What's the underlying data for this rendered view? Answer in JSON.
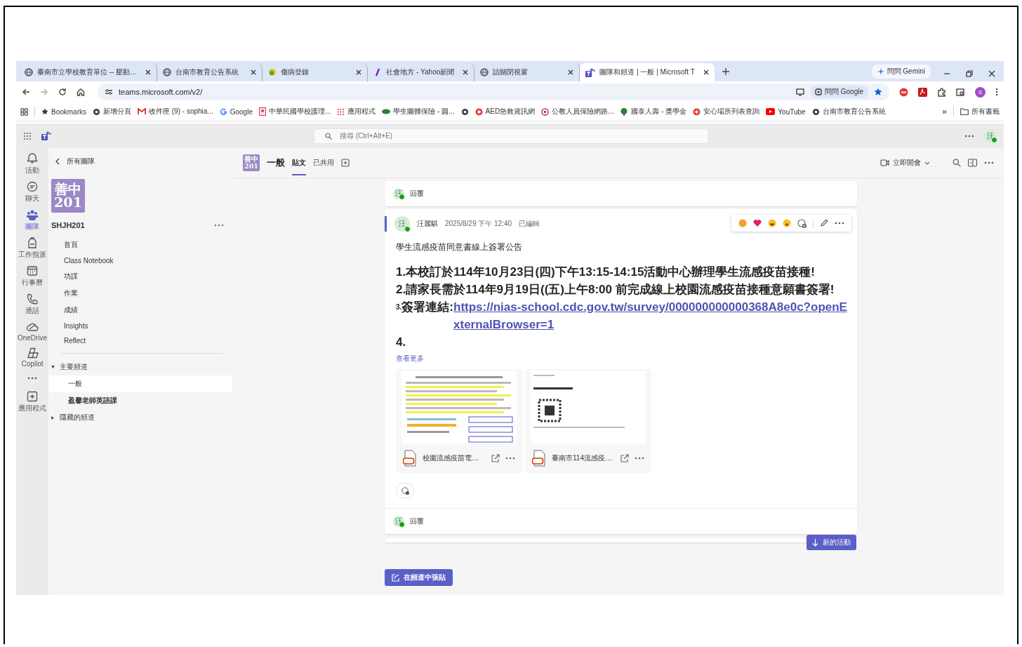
{
  "browser": {
    "tabs": [
      {
        "title": "臺南市立學校教育單位 -- 壓動…",
        "selected": false
      },
      {
        "title": "台南市教育公告系統",
        "selected": false
      },
      {
        "title": "傷病登錄",
        "selected": false
      },
      {
        "title": "社會地方 - Yahoo新聞",
        "selected": false
      },
      {
        "title": "請關閉視窗",
        "selected": false
      },
      {
        "title": "團隊和頻道 | 一般 | Microsoft T",
        "selected": true
      }
    ],
    "gemini": "問問 Gemini",
    "address": "teams.microsoft.com/v2/",
    "lens": "問問 Google",
    "profile": "S",
    "bookmarks": [
      "Bookmarks",
      "新增分頁",
      "收件匣 (9) - sophia...",
      "Google",
      "中華民國學校護理...",
      "應用程式",
      "學生團體保險 - 圓...",
      "AED急救資訊網",
      "公教人員保險網路...",
      "國泰人壽 - 獎學金",
      "安心場所列表查詢",
      "YouTube",
      "台南市教育公告系統"
    ],
    "more_bookmarks": "»",
    "all_bookmarks": "所有書籤"
  },
  "teams": {
    "search": {
      "placeholder": "搜尋 (Ctrl+Alt+E)"
    },
    "me": "汪",
    "rail": [
      {
        "label": "活動",
        "selected": false
      },
      {
        "label": "聊天",
        "selected": false
      },
      {
        "label": "團隊",
        "selected": true
      },
      {
        "label": "工作指派",
        "selected": false
      },
      {
        "label": "行事曆",
        "selected": false
      },
      {
        "label": "通話",
        "selected": false
      },
      {
        "label": "OneDrive",
        "selected": false
      },
      {
        "label": "Copilot",
        "selected": false
      },
      {
        "label": "應用程式",
        "selected": false
      }
    ],
    "team": {
      "back": "所有團隊",
      "logo": [
        "善中",
        "201"
      ],
      "name": "SHJH201",
      "pages": [
        "首頁",
        "Class Notebook",
        "功課",
        "作業",
        "成績",
        "Insights",
        "Reflect"
      ],
      "sections": [
        {
          "label": "主要頻道",
          "expanded": true,
          "channels": [
            {
              "label": "一般",
              "selected": true
            },
            {
              "label": "盈馨老師英語課",
              "selected": false
            }
          ]
        },
        {
          "label": "隱藏的頻道",
          "expanded": false
        }
      ]
    },
    "channel": {
      "logo": [
        "善中",
        "201"
      ],
      "name": "一般",
      "tabs": [
        {
          "label": "貼文",
          "selected": true
        },
        {
          "label": "已共用",
          "selected": false
        }
      ],
      "meet": "立即開會"
    },
    "feed": {
      "top_reply": {
        "avatar": "汪",
        "label": "回覆"
      },
      "post": {
        "avatar": "汪",
        "author": "汪麗騏",
        "time": "2025/8/29 下午 12:40",
        "edited": "已編輯",
        "subject": "學生流感疫苗同意書線上簽署公告",
        "lines": [
          "1.本校訂於114年10月23日(四)下午13:15-14:15活動中心辦理學生流感疫苗接種!",
          "2.請家長需於114年9月19日((五)上午8:00 前完成線上校園流感疫苗接種意願書簽署!"
        ],
        "link_line": {
          "number": "3.",
          "label": "簽署連結:",
          "url": "https://nias-school.cdc.gov.tw/survey/000000000000368A8e0c?openExternalBrowser=1"
        },
        "last_line": "4.",
        "see_more": "查看更多",
        "files": [
          {
            "name": "校園流感疫苗電…"
          },
          {
            "name": "臺南市114流感疫…"
          }
        ],
        "reply": {
          "avatar": "汪",
          "label": "回覆"
        }
      },
      "new_activity": "新的活動",
      "compose": "在頻道中張貼"
    }
  }
}
